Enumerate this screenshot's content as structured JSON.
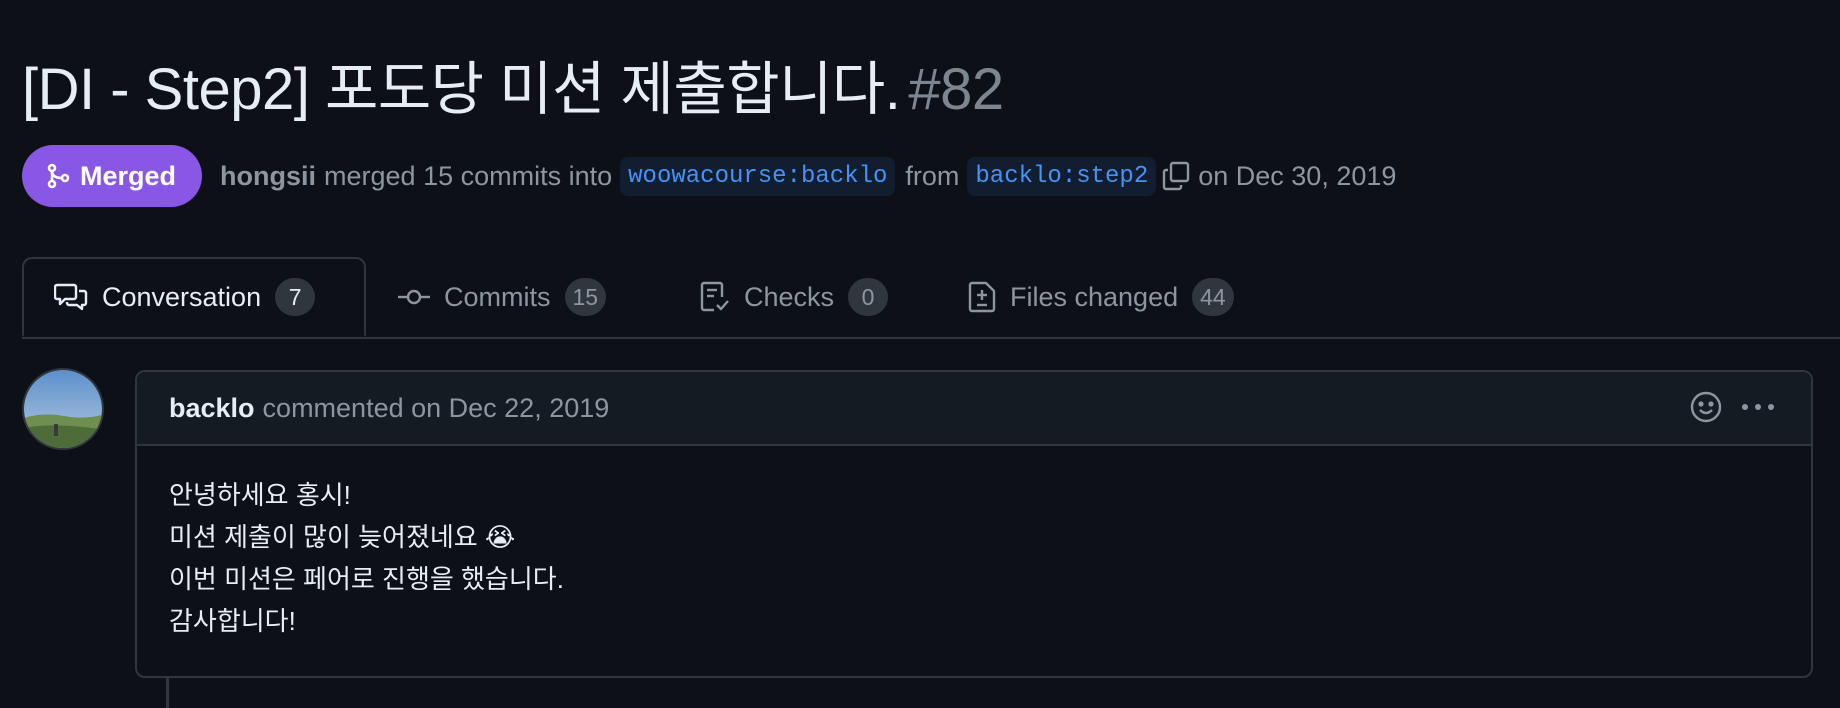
{
  "pr": {
    "title": "[DI - Step2] 포도당 미션 제출합니다.",
    "number": "#82",
    "status": "Merged",
    "author": "hongsii",
    "merged_text": "merged 15 commits into",
    "base_branch": "woowacourse:backlo",
    "from_text": "from",
    "head_branch": "backlo:step2",
    "date_text": "on Dec 30, 2019",
    "status_color": "#8957e5"
  },
  "tabs": [
    {
      "label": "Conversation",
      "count": "7",
      "icon": "comment-discussion-icon"
    },
    {
      "label": "Commits",
      "count": "15",
      "icon": "git-commit-icon"
    },
    {
      "label": "Checks",
      "count": "0",
      "icon": "checklist-icon"
    },
    {
      "label": "Files changed",
      "count": "44",
      "icon": "file-diff-icon"
    }
  ],
  "comment": {
    "author": "backlo",
    "action": "commented on Dec 22, 2019",
    "lines": [
      "안녕하세요 홍시!",
      "미션 제출이 많이 늦어졌네요 😭",
      "이번 미션은 페어로 진행을 했습니다.",
      "감사합니다!"
    ]
  }
}
